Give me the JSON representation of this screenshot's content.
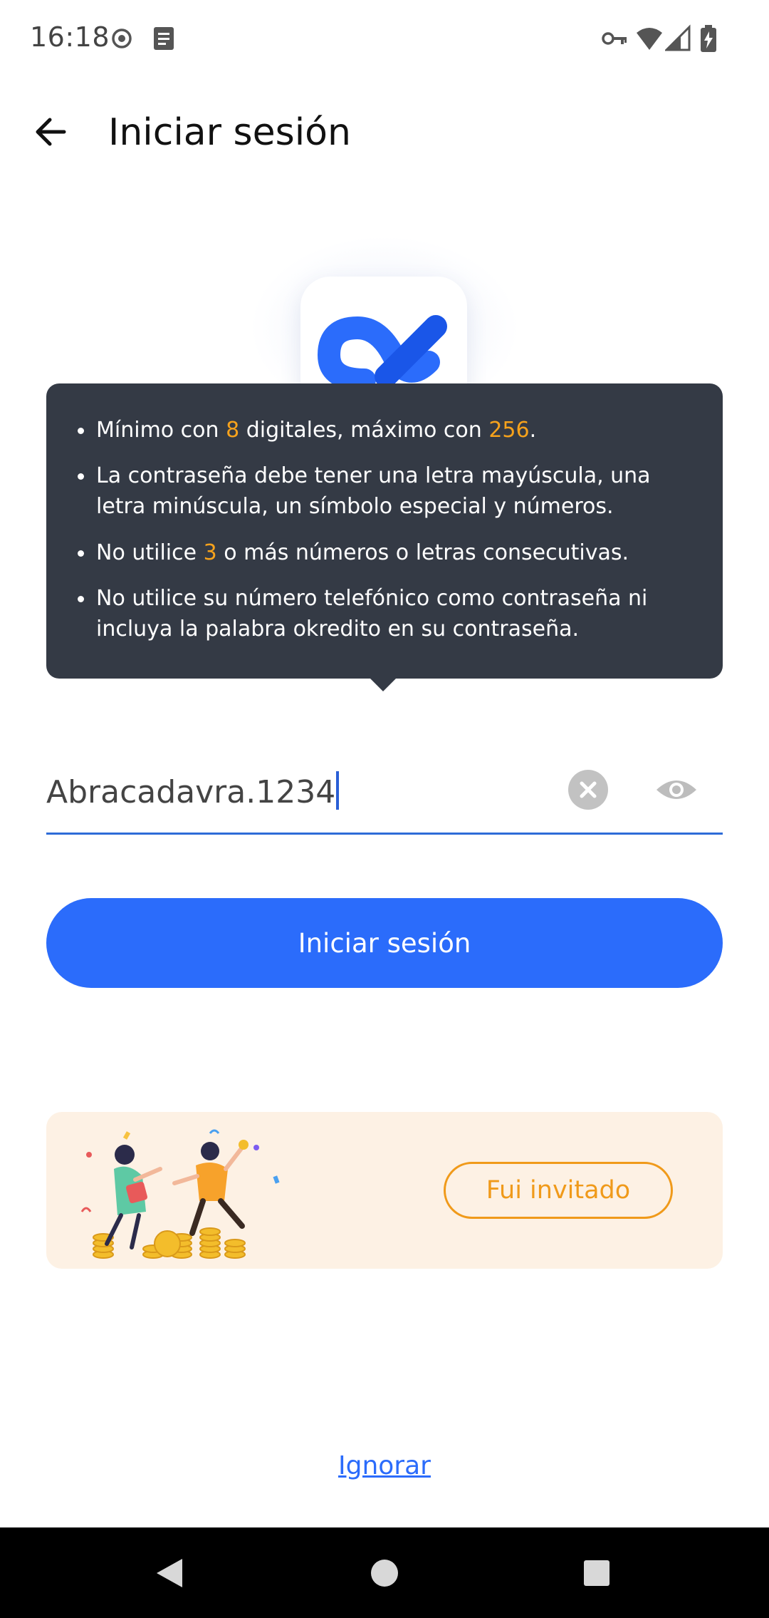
{
  "status_bar": {
    "time": "16:18",
    "icons_left": [
      "record-icon",
      "document-icon"
    ],
    "icons_right": [
      "vpn-key-icon",
      "wifi-icon",
      "cell-signal-icon",
      "battery-charging-icon"
    ]
  },
  "header": {
    "back_icon": "arrow-left-icon",
    "title": "Iniciar sesión"
  },
  "logo": {
    "icon": "app-logo-icon",
    "colors": [
      "#2b6cfb",
      "#1a4fd8"
    ]
  },
  "tooltip": {
    "rules": [
      {
        "parts": [
          {
            "text": "Mínimo con ",
            "highlight": false
          },
          {
            "text": "8",
            "highlight": true
          },
          {
            "text": " digitales, máximo con ",
            "highlight": false
          },
          {
            "text": "256",
            "highlight": true
          },
          {
            "text": ".",
            "highlight": false
          }
        ]
      },
      {
        "parts": [
          {
            "text": "La contraseña debe tener una letra mayúscula, una letra minúscula, un símbolo especial y números.",
            "highlight": false
          }
        ]
      },
      {
        "parts": [
          {
            "text": "No utilice ",
            "highlight": false
          },
          {
            "text": "3",
            "highlight": true
          },
          {
            "text": " o más números o letras consecutivas.",
            "highlight": false
          }
        ]
      },
      {
        "parts": [
          {
            "text": "No utilice su número telefónico como contraseña ni incluya la palabra okredito en su contraseña.",
            "highlight": false
          }
        ]
      }
    ],
    "highlight_color": "#f6a21c",
    "background": "#343a45"
  },
  "password_input": {
    "value": "Abracadavra.1234",
    "clear_icon": "clear-icon",
    "visibility_icon": "eye-icon"
  },
  "login_button": {
    "label": "Iniciar sesión",
    "color": "#2b6cfb"
  },
  "invite_card": {
    "button_label": "Fui invitado",
    "accent_color": "#f09a1a",
    "background": "#fdf1e4",
    "illustration": "celebrating-people-coins-illustration"
  },
  "skip_link": {
    "label": "Ignorar"
  },
  "nav_bar": {
    "icons": [
      "back-triangle-icon",
      "home-circle-icon",
      "recents-square-icon"
    ]
  }
}
